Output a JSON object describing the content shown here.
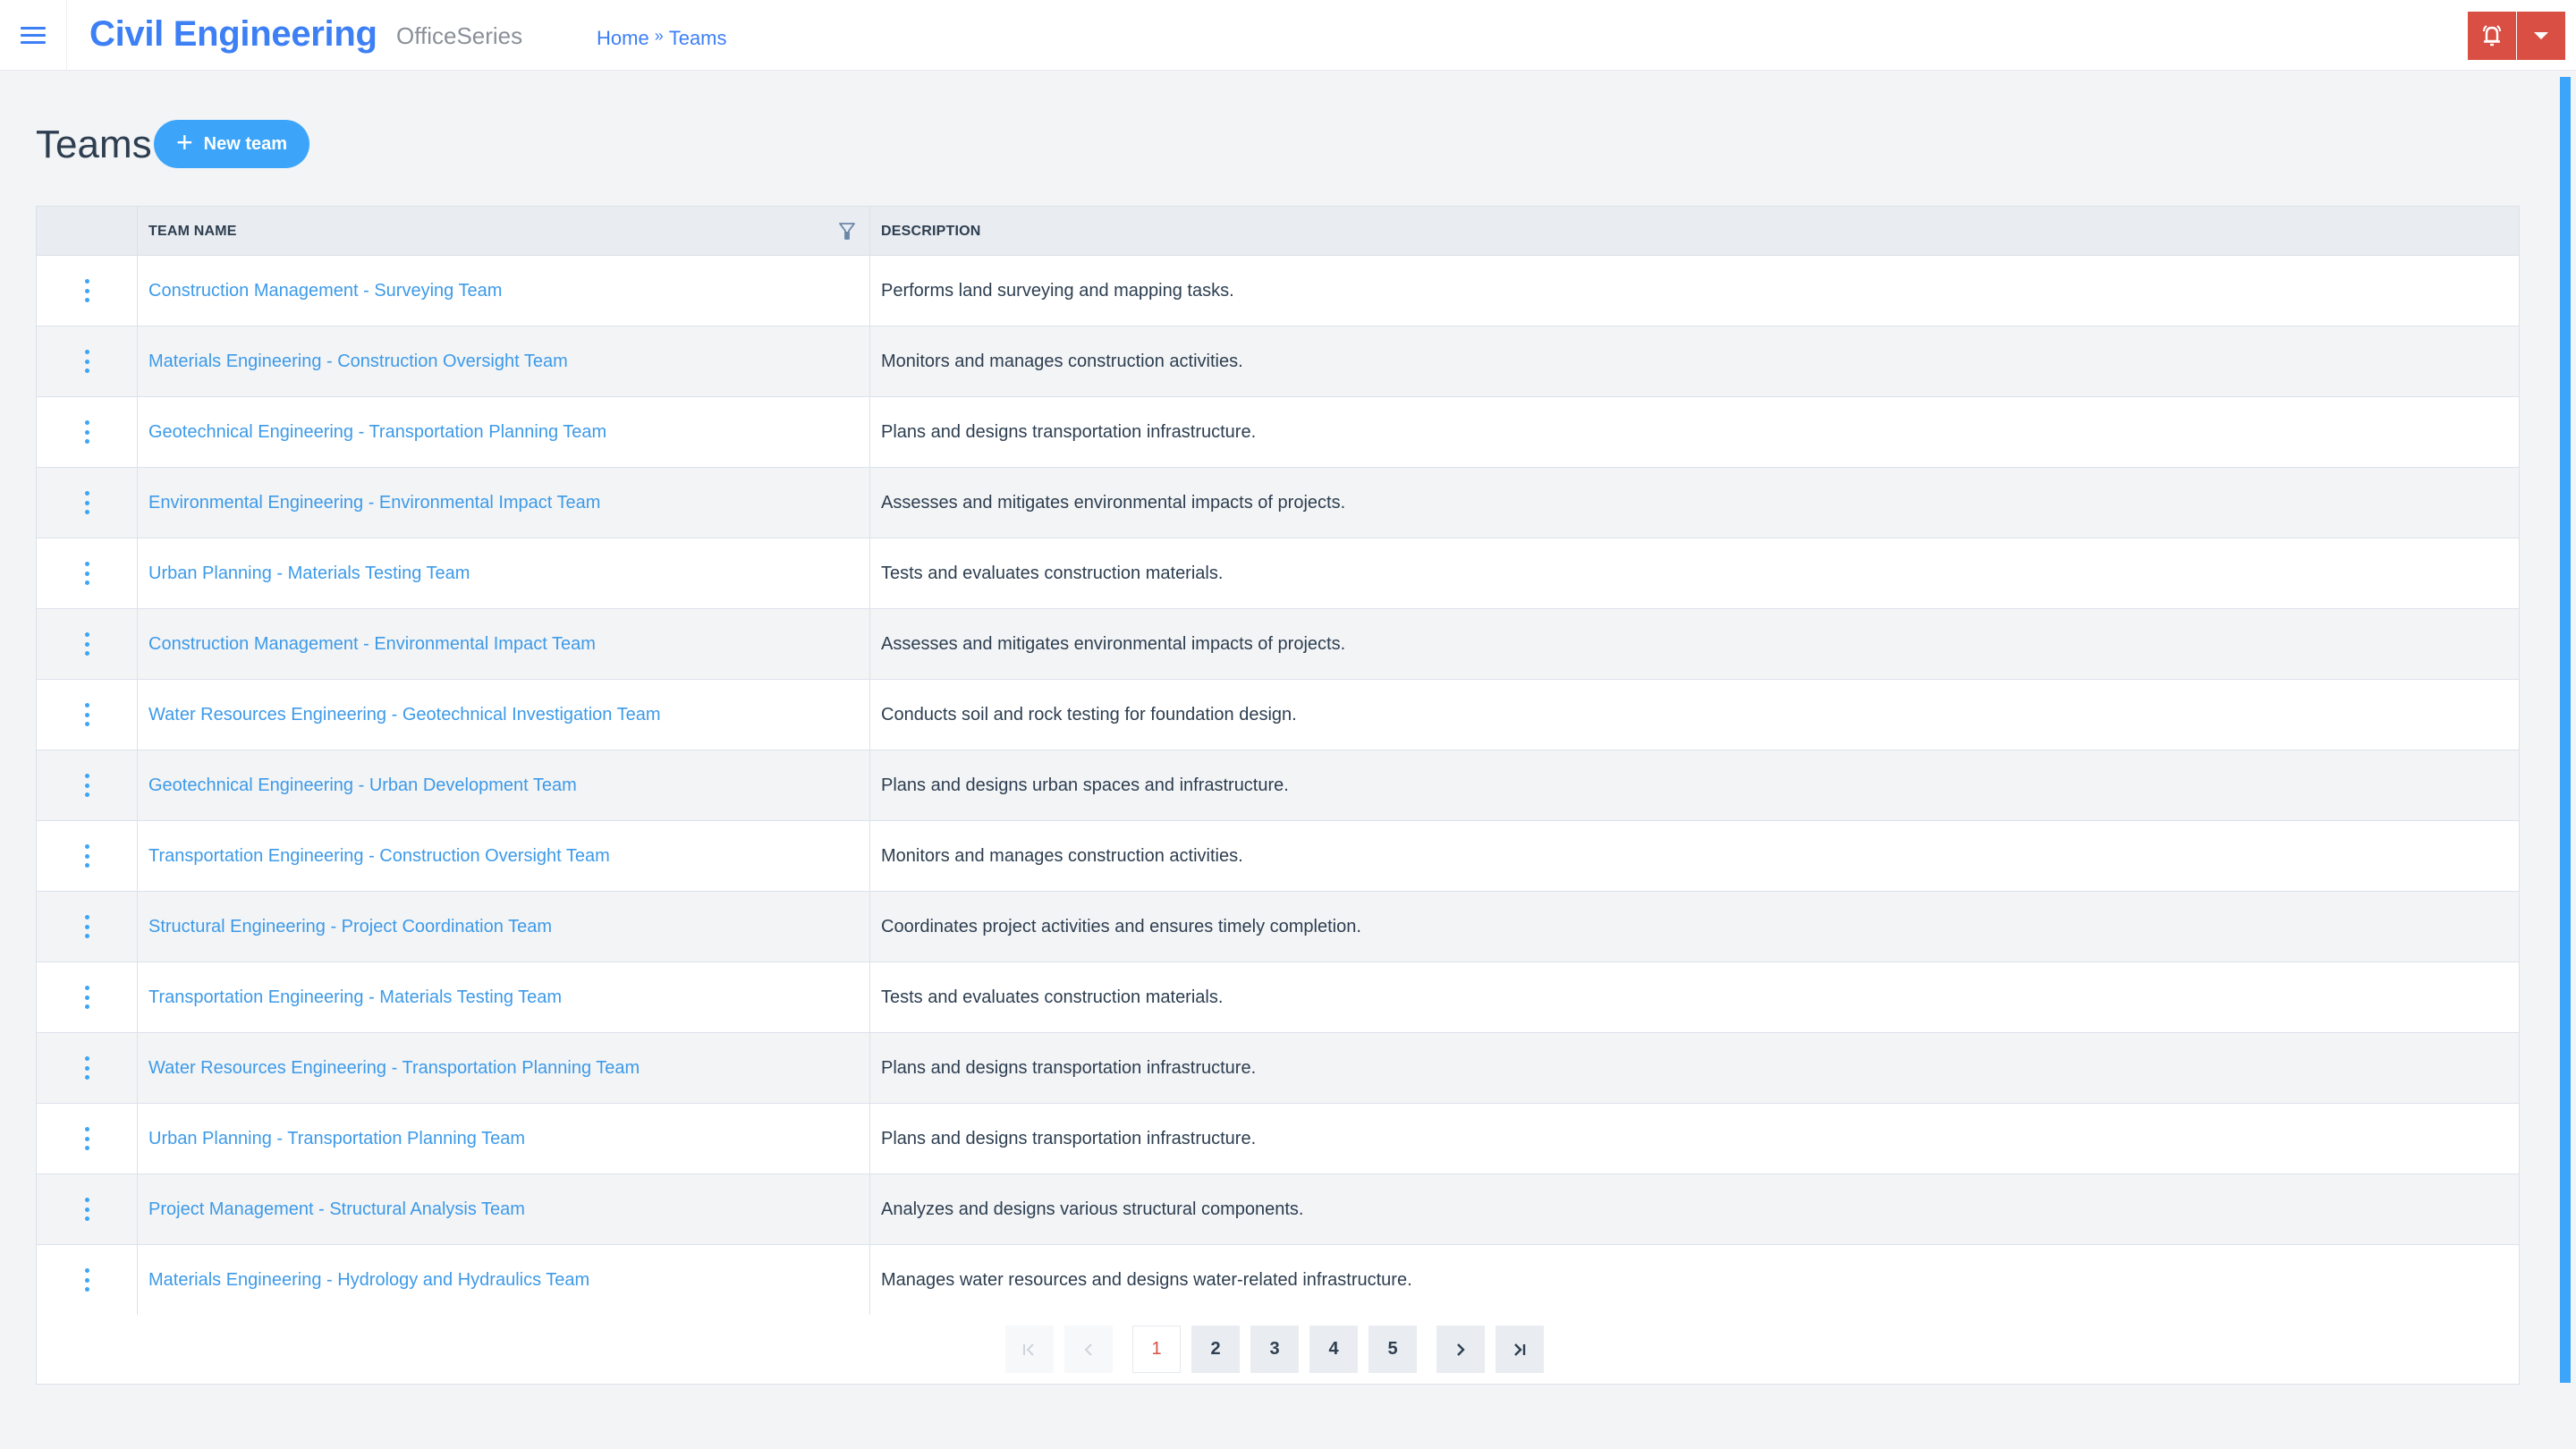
{
  "header": {
    "menu_icon": "hamburger-icon",
    "app_title": "Civil Engineering",
    "app_subtitle": "OfficeSeries",
    "breadcrumb": [
      {
        "label": "Home"
      },
      {
        "label": "Teams"
      }
    ],
    "breadcrumb_separator": "»",
    "alert_icon": "alarm-bell-icon",
    "dropdown_icon": "caret-down-icon",
    "accent_color": "#3d7ff5",
    "alert_color": "#d94f43"
  },
  "page": {
    "title": "Teams",
    "new_button_label": "New team",
    "new_button_icon": "plus-icon"
  },
  "table": {
    "columns": [
      {
        "label": ""
      },
      {
        "label": "TEAM NAME",
        "filter_icon": "filter-icon"
      },
      {
        "label": "DESCRIPTION"
      }
    ],
    "rows": [
      {
        "name": "Construction Management - Surveying Team",
        "description": "Performs land surveying and mapping tasks."
      },
      {
        "name": "Materials Engineering - Construction Oversight Team",
        "description": "Monitors and manages construction activities."
      },
      {
        "name": "Geotechnical Engineering - Transportation Planning Team",
        "description": "Plans and designs transportation infrastructure."
      },
      {
        "name": "Environmental Engineering - Environmental Impact Team",
        "description": "Assesses and mitigates environmental impacts of projects."
      },
      {
        "name": "Urban Planning - Materials Testing Team",
        "description": "Tests and evaluates construction materials."
      },
      {
        "name": "Construction Management - Environmental Impact Team",
        "description": "Assesses and mitigates environmental impacts of projects."
      },
      {
        "name": "Water Resources Engineering - Geotechnical Investigation Team",
        "description": "Conducts soil and rock testing for foundation design."
      },
      {
        "name": "Geotechnical Engineering - Urban Development Team",
        "description": "Plans and designs urban spaces and infrastructure."
      },
      {
        "name": "Transportation Engineering - Construction Oversight Team",
        "description": "Monitors and manages construction activities."
      },
      {
        "name": "Structural Engineering - Project Coordination Team",
        "description": "Coordinates project activities and ensures timely completion."
      },
      {
        "name": "Transportation Engineering - Materials Testing Team",
        "description": "Tests and evaluates construction materials."
      },
      {
        "name": "Water Resources Engineering - Transportation Planning Team",
        "description": "Plans and designs transportation infrastructure."
      },
      {
        "name": "Urban Planning - Transportation Planning Team",
        "description": "Plans and designs transportation infrastructure."
      },
      {
        "name": "Project Management - Structural Analysis Team",
        "description": "Analyzes and designs various structural components."
      },
      {
        "name": "Materials Engineering - Hydrology and Hydraulics Team",
        "description": "Manages water resources and designs water-related infrastructure."
      }
    ],
    "row_action_icon": "kebab-menu-icon"
  },
  "pagination": {
    "first_label": "|<",
    "prev_label": "<",
    "pages": [
      "1",
      "2",
      "3",
      "4",
      "5"
    ],
    "current_page": "1",
    "next_label": ">",
    "last_label": ">|"
  }
}
